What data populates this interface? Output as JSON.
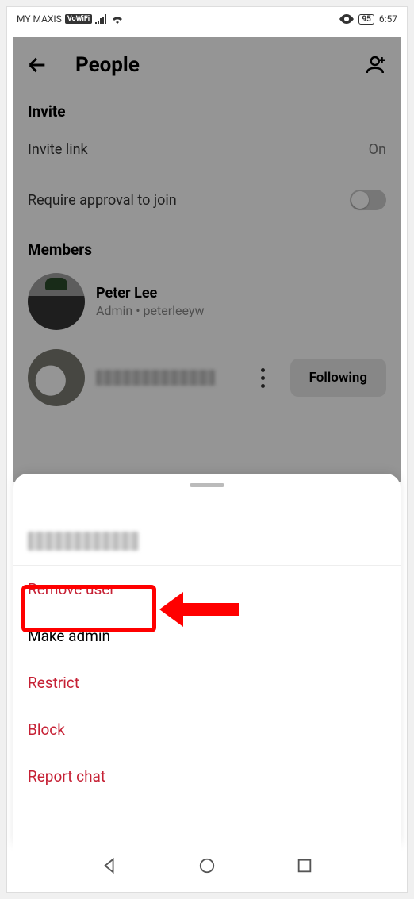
{
  "status": {
    "carrier": "MY MAXIS",
    "vowifi": "VoWiFi",
    "battery": "95",
    "time": "6:57"
  },
  "header": {
    "title": "People"
  },
  "invite": {
    "title": "Invite",
    "link_label": "Invite link",
    "link_value": "On",
    "approval_label": "Require approval to join"
  },
  "members": {
    "title": "Members",
    "list": [
      {
        "name": "Peter Lee",
        "sub": "Admin • peterleeyw"
      },
      {
        "name": "",
        "sub": ""
      }
    ],
    "follow_label": "Following"
  },
  "sheet": {
    "items": [
      {
        "label": "Remove user",
        "danger": true
      },
      {
        "label": "Make admin",
        "danger": false
      },
      {
        "label": "Restrict",
        "danger": true
      },
      {
        "label": "Block",
        "danger": true
      },
      {
        "label": "Report chat",
        "danger": true
      }
    ]
  }
}
